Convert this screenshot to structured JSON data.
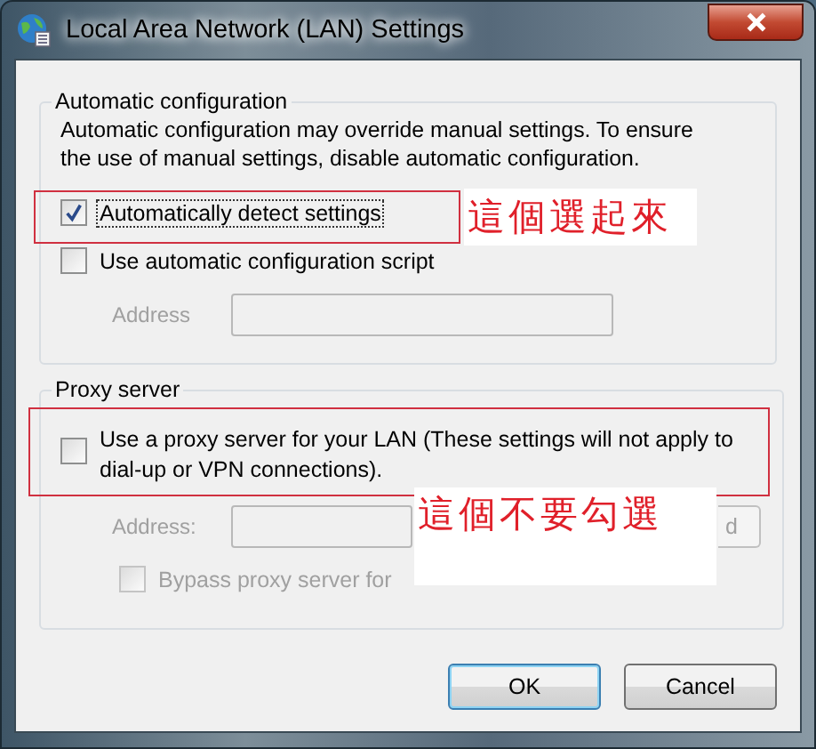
{
  "window": {
    "title": "Local Area Network (LAN) Settings"
  },
  "automatic_configuration": {
    "title": "Automatic configuration",
    "description": "Automatic configuration may override manual settings.  To ensure the use of manual settings, disable automatic configuration.",
    "options": [
      {
        "label": "Automatically detect settings",
        "checked": true,
        "focused": true
      },
      {
        "label": "Use automatic configuration script",
        "checked": false,
        "focused": false
      }
    ],
    "address": {
      "label": "Address",
      "disabled": true
    }
  },
  "proxy_server": {
    "title": "Proxy server",
    "use_proxy": {
      "label": "Use a proxy server for your LAN (These settings will not apply to dial-up or VPN connections).",
      "checked": false
    },
    "address": {
      "label": "Address:",
      "disabled": true
    },
    "advanced_button": {
      "label": "d",
      "disabled": true
    },
    "bypass": {
      "label": "Bypass proxy server for",
      "checked": false,
      "disabled": true
    }
  },
  "buttons": [
    {
      "label": "OK",
      "default": true
    },
    {
      "label": "Cancel",
      "default": false
    }
  ],
  "annotations": [
    {
      "text": "這個選起來"
    },
    {
      "text": "這個不要勾選"
    }
  ]
}
